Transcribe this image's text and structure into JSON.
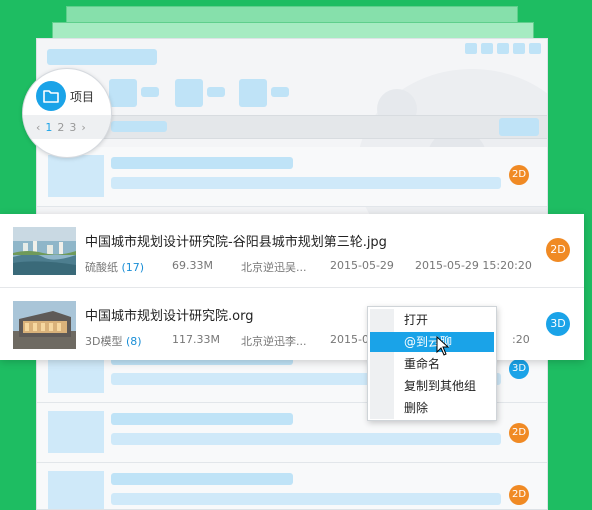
{
  "sidebar": {
    "folder_label": "项目",
    "pager": {
      "prev": "‹",
      "pages": [
        "1",
        "2",
        "3"
      ],
      "current": "1",
      "next": "›"
    }
  },
  "files": [
    {
      "name": "中国城市规划设计研究院-谷阳县城市规划第三轮.jpg",
      "type": "硫酸纸",
      "count": "(17)",
      "size": "69.33M",
      "owner": "北京逆迅吴...",
      "date": "2015-05-29",
      "modified": "2015-05-29 15:20:20",
      "badge": "2D"
    },
    {
      "name": "中国城市规划设计研究院.org",
      "type": "3D模型",
      "count": "(8)",
      "size": "117.33M",
      "owner": "北京逆迅李...",
      "date": "2015-05-29",
      "modified_tail": ":20",
      "badge": "3D"
    }
  ],
  "background_badges": [
    "2D",
    "3D",
    "2D",
    "2D"
  ],
  "context_menu": {
    "items": [
      "打开",
      "@到云聊",
      "重命名",
      "复制到其他组",
      "删除"
    ],
    "active_index": 1
  },
  "colors": {
    "background": "#1ebd62",
    "accent_blue": "#1aa3e8",
    "badge_orange": "#f08a24",
    "placeholder": "#bfe3f7"
  },
  "icons": [
    "folder-icon",
    "chevron-left-icon",
    "chevron-right-icon",
    "mouse-cursor-icon"
  ]
}
